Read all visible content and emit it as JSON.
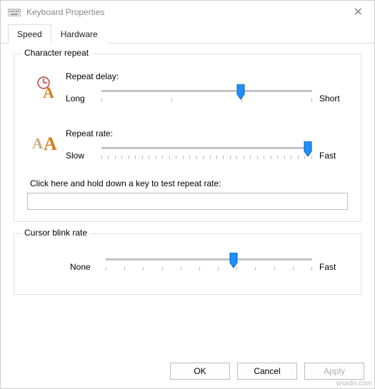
{
  "window": {
    "title": "Keyboard Properties"
  },
  "tabs": {
    "speed": "Speed",
    "hardware": "Hardware"
  },
  "charRepeat": {
    "legend": "Character repeat",
    "delay": {
      "label": "Repeat delay:",
      "min": "Long",
      "max": "Short",
      "position_pct": 66,
      "ticks": 4
    },
    "rate": {
      "label": "Repeat rate:",
      "min": "Slow",
      "max": "Fast",
      "position_pct": 98,
      "ticks": 32
    },
    "test": {
      "label": "Click here and hold down a key to test repeat rate:",
      "value": ""
    }
  },
  "cursor": {
    "legend": "Cursor blink rate",
    "slider": {
      "min": "None",
      "max": "Fast",
      "position_pct": 62,
      "ticks": 12
    }
  },
  "footer": {
    "ok": "OK",
    "cancel": "Cancel",
    "apply": "Apply"
  },
  "watermark": "wsxdn.com"
}
